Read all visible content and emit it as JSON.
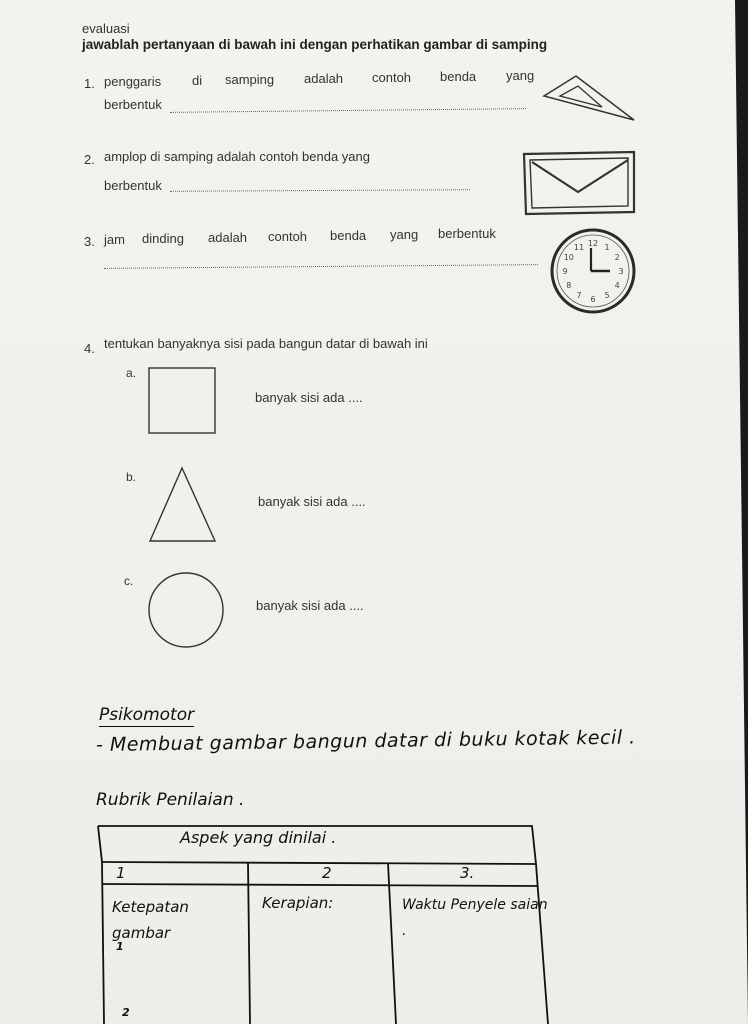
{
  "header": {
    "title": "evaluasi",
    "instruction": "jawablah pertanyaan di bawah ini dengan perhatikan gambar di samping"
  },
  "questions": [
    {
      "number": "1.",
      "words": [
        "penggaris",
        "di",
        "samping",
        "adalah",
        "contoh",
        "benda",
        "yang"
      ],
      "line2": "berbentuk",
      "picture": "set-square-icon"
    },
    {
      "number": "2.",
      "text": "amplop di samping adalah contoh benda yang",
      "line2": "berbentuk",
      "picture": "envelope-icon"
    },
    {
      "number": "3.",
      "words": [
        "jam",
        "dinding",
        "adalah",
        "contoh",
        "benda",
        "yang",
        "berbentuk"
      ],
      "picture": "wall-clock-icon",
      "clock_numbers": [
        "12",
        "1",
        "2",
        "3",
        "4",
        "5",
        "6",
        "7",
        "8",
        "9",
        "10",
        "11"
      ]
    },
    {
      "number": "4.",
      "text": "tentukan banyaknya sisi pada bangun datar di bawah ini",
      "items": [
        {
          "label": "a.",
          "text": "banyak sisi ada ....",
          "shape": "square"
        },
        {
          "label": "b.",
          "text": "banyak sisi ada ....",
          "shape": "triangle"
        },
        {
          "label": "c.",
          "text": "banyak sisi ada ....",
          "shape": "circle"
        }
      ]
    }
  ],
  "psikomotor": {
    "heading": "Psikomotor",
    "task": "- Membuat gambar bangun datar di buku kotak kecil ."
  },
  "rubrik": {
    "heading": "Rubrik Penilaian .",
    "table_title": "Aspek yang dinilai .",
    "columns": [
      "1",
      "2",
      "3."
    ],
    "cells": [
      "Ketepatan gambar",
      "Kerapian:",
      "Waktu Penyele saian ."
    ],
    "row_marks": [
      "1",
      "2"
    ]
  },
  "colors": {
    "paper": "#f1f0ec",
    "ink": "#111111",
    "print": "#333333"
  }
}
